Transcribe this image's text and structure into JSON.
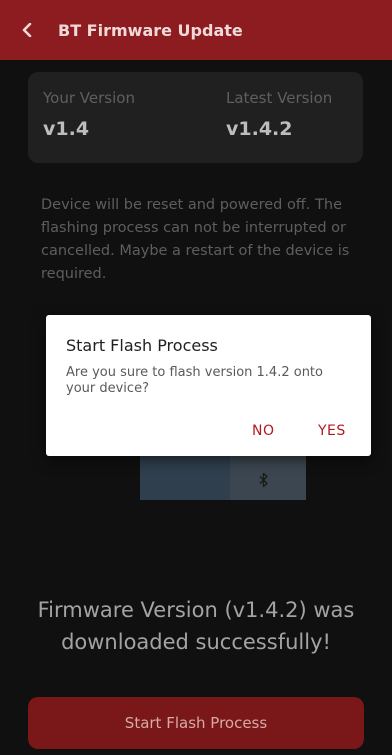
{
  "header": {
    "title": "BT Firmware Update",
    "back_icon": "chevron-left-icon"
  },
  "versions": {
    "current_label": "Your Version",
    "current_value": "v1.4",
    "latest_label": "Latest Version",
    "latest_value": "v1.4.2"
  },
  "warning_text": "Device will be reset and powered off. The flashing process can not be interrupted or cancelled. Maybe a restart of the device is required.",
  "device_image": {
    "icon": "bluetooth-icon"
  },
  "success_text": "Firmware Version (v1.4.2) was downloaded successfully!",
  "primary_button": {
    "label": "Start Flash Process"
  },
  "dialog": {
    "title": "Start Flash Process",
    "message": "Are you sure to flash version 1.4.2 onto your device?",
    "no_label": "NO",
    "yes_label": "YES"
  },
  "colors": {
    "accent": "#8c1c1f",
    "dialog_button": "#b31a1f",
    "background": "#101010"
  }
}
